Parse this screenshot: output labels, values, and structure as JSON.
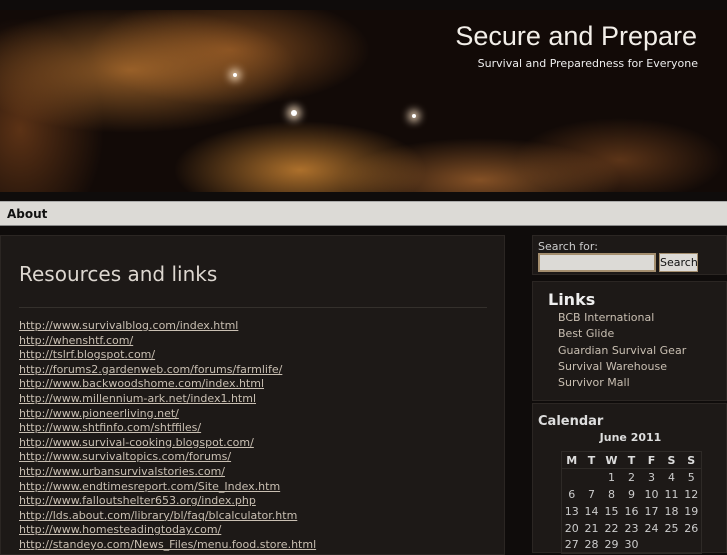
{
  "header": {
    "title": "Secure and Prepare",
    "tagline": "Survival and Preparedness for Everyone"
  },
  "nav": {
    "items": [
      "About"
    ]
  },
  "main": {
    "title": "Resources and links",
    "links": [
      "http://www.survivalblog.com/index.html",
      "http://whenshtf.com/",
      "http://tslrf.blogspot.com/",
      "http://forums2.gardenweb.com/forums/farmlife/",
      "http://www.backwoodshome.com/index.html",
      "http://www.millennium-ark.net/index1.html",
      "http://www.pioneerliving.net/",
      "http://www.shtfinfo.com/shtffiles/",
      "http://www.survival-cooking.blogspot.com/",
      "http://www.survivaltopics.com/forums/",
      "http://www.urbansurvivalstories.com/",
      "http://www.endtimesreport.com/Site_Index.htm",
      "http://www.falloutshelter653.org/index.php",
      "http://lds.about.com/library/bl/faq/blcalculator.htm",
      "http://www.homesteadingtoday.com/",
      "http://standeyo.com/News_Files/menu.food.store.html"
    ]
  },
  "search": {
    "label": "Search for:",
    "value": "",
    "button": "Search"
  },
  "links_widget": {
    "title": "Links",
    "items": [
      "BCB International",
      "Best Glide",
      "Guardian Survival Gear",
      "Survival Warehouse",
      "Survivor Mall"
    ]
  },
  "calendar": {
    "title": "Calendar",
    "caption": "June 2011",
    "days": [
      "M",
      "T",
      "W",
      "T",
      "F",
      "S",
      "S"
    ],
    "weeks": [
      [
        "",
        "",
        "1",
        "2",
        "3",
        "4",
        "5"
      ],
      [
        "6",
        "7",
        "8",
        "9",
        "10",
        "11",
        "12"
      ],
      [
        "13",
        "14",
        "15",
        "16",
        "17",
        "18",
        "19"
      ],
      [
        "20",
        "21",
        "22",
        "23",
        "24",
        "25",
        "26"
      ],
      [
        "27",
        "28",
        "29",
        "30",
        "",
        "",
        ""
      ]
    ]
  }
}
